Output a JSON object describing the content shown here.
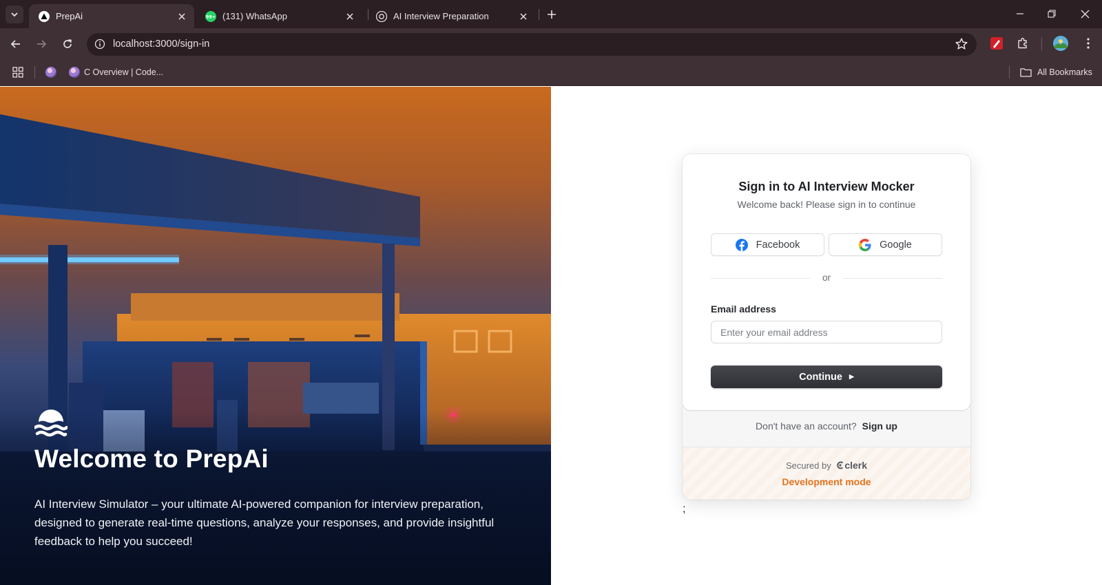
{
  "browser": {
    "tabs": [
      {
        "title": "PrepAi",
        "active": true
      },
      {
        "title": "(131) WhatsApp",
        "active": false,
        "badge": "99+"
      },
      {
        "title": "AI Interview Preparation",
        "active": false
      }
    ],
    "url": "localhost:3000/sign-in",
    "bookmarks": [
      {
        "label": ""
      },
      {
        "label": "C Overview | Code..."
      }
    ],
    "all_bookmarks_label": "All Bookmarks",
    "colors": {
      "tabbar": "#2b1f23",
      "toolbar": "#3f3035",
      "omnibox": "#2a1e22"
    }
  },
  "hero": {
    "title": "Welcome to PrepAi",
    "description": "AI Interview Simulator – your ultimate AI-powered companion for interview preparation, designed to generate real-time questions, analyze your responses, and provide insightful feedback to help you succeed!",
    "logo_icon": "waves-icon"
  },
  "signin": {
    "title": "Sign in to AI Interview Mocker",
    "subtitle": "Welcome back! Please sign in to continue",
    "facebook_label": "Facebook",
    "google_label": "Google",
    "divider_text": "or",
    "email_label": "Email address",
    "email_placeholder": "Enter your email address",
    "email_value": "",
    "continue_label": "Continue",
    "signup_prompt": "Don't have an account?",
    "signup_link": "Sign up",
    "secured_by": "Secured by",
    "clerk_brand": "clerk",
    "dev_mode": "Development mode",
    "accent_color": "#e2731e"
  },
  "stray_text": ";"
}
